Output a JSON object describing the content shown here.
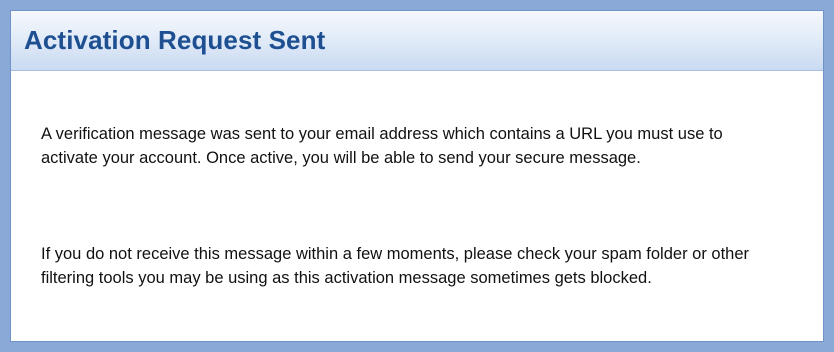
{
  "dialog": {
    "title": "Activation Request Sent",
    "paragraphs": [
      "A verification message was sent to your email address which contains a URL you must use to activate your account. Once active, you will be able to send your secure message.",
      "If you do not receive this message within a few moments, please check your spam folder or other filtering tools you may be using as this activation message sometimes gets blocked."
    ]
  },
  "colors": {
    "background": "#8aa9d6",
    "title_text": "#1d4f91",
    "title_bar_top": "#f5f8fd",
    "title_bar_bottom": "#c9daf2",
    "body_text": "#111111"
  }
}
